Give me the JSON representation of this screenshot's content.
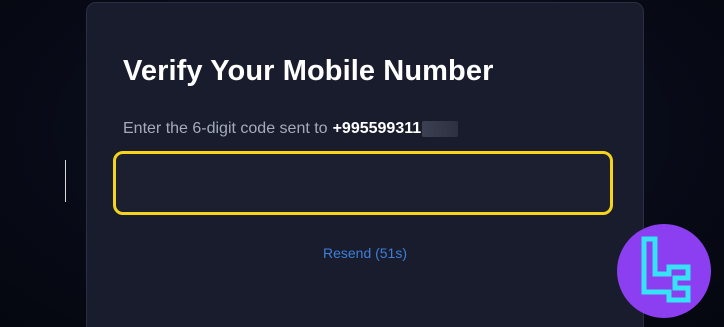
{
  "card": {
    "title": "Verify Your Mobile Number",
    "subtitle_prefix": "Enter the 6-digit code sent to",
    "phone_visible": "+995599311",
    "code_input_value": "",
    "code_input_placeholder": "",
    "resend_label": "Resend (51s)"
  },
  "colors": {
    "card_background": "#181c2d",
    "input_border": "#f5d41c",
    "link": "#3e7fd7",
    "logo_background": "#8b3ff0",
    "logo_stroke": "#35e3f5"
  },
  "icons": {
    "logo": "tc-logo-icon"
  }
}
